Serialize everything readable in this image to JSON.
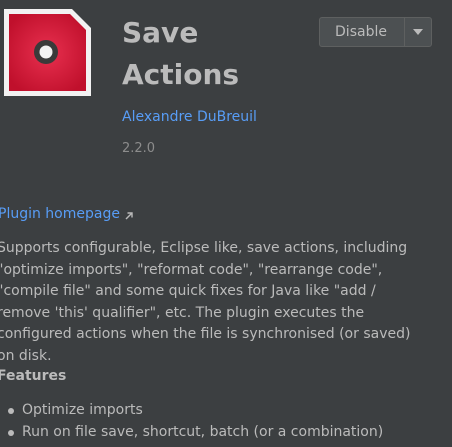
{
  "plugin": {
    "name": "Save Actions",
    "vendor": "Alexandre DuBreuil",
    "version": "2.2.0",
    "logo_icon": "save-actions-logo-icon"
  },
  "actions": {
    "disable_label": "Disable",
    "dropdown_icon": "chevron-down-icon"
  },
  "links": {
    "homepage_label": "Plugin homepage",
    "homepage_icon": "external-link-icon"
  },
  "description": "Supports configurable, Eclipse like, save actions, including \"optimize imports\", \"reformat code\", \"rearrange code\", \"compile file\" and some quick fixes for Java like \"add / remove 'this' qualifier\", etc. The plugin executes the configured actions when the file is synchronised (or saved) on disk.",
  "features": {
    "heading": "Features",
    "items": [
      "Optimize imports",
      "Run on file save, shortcut, batch (or a combination)"
    ]
  },
  "colors": {
    "background": "#3c3f41",
    "text": "#bbbbbb",
    "link": "#589df6",
    "logo_red": "#c8102e",
    "version_gray": "#8c8c8c"
  }
}
